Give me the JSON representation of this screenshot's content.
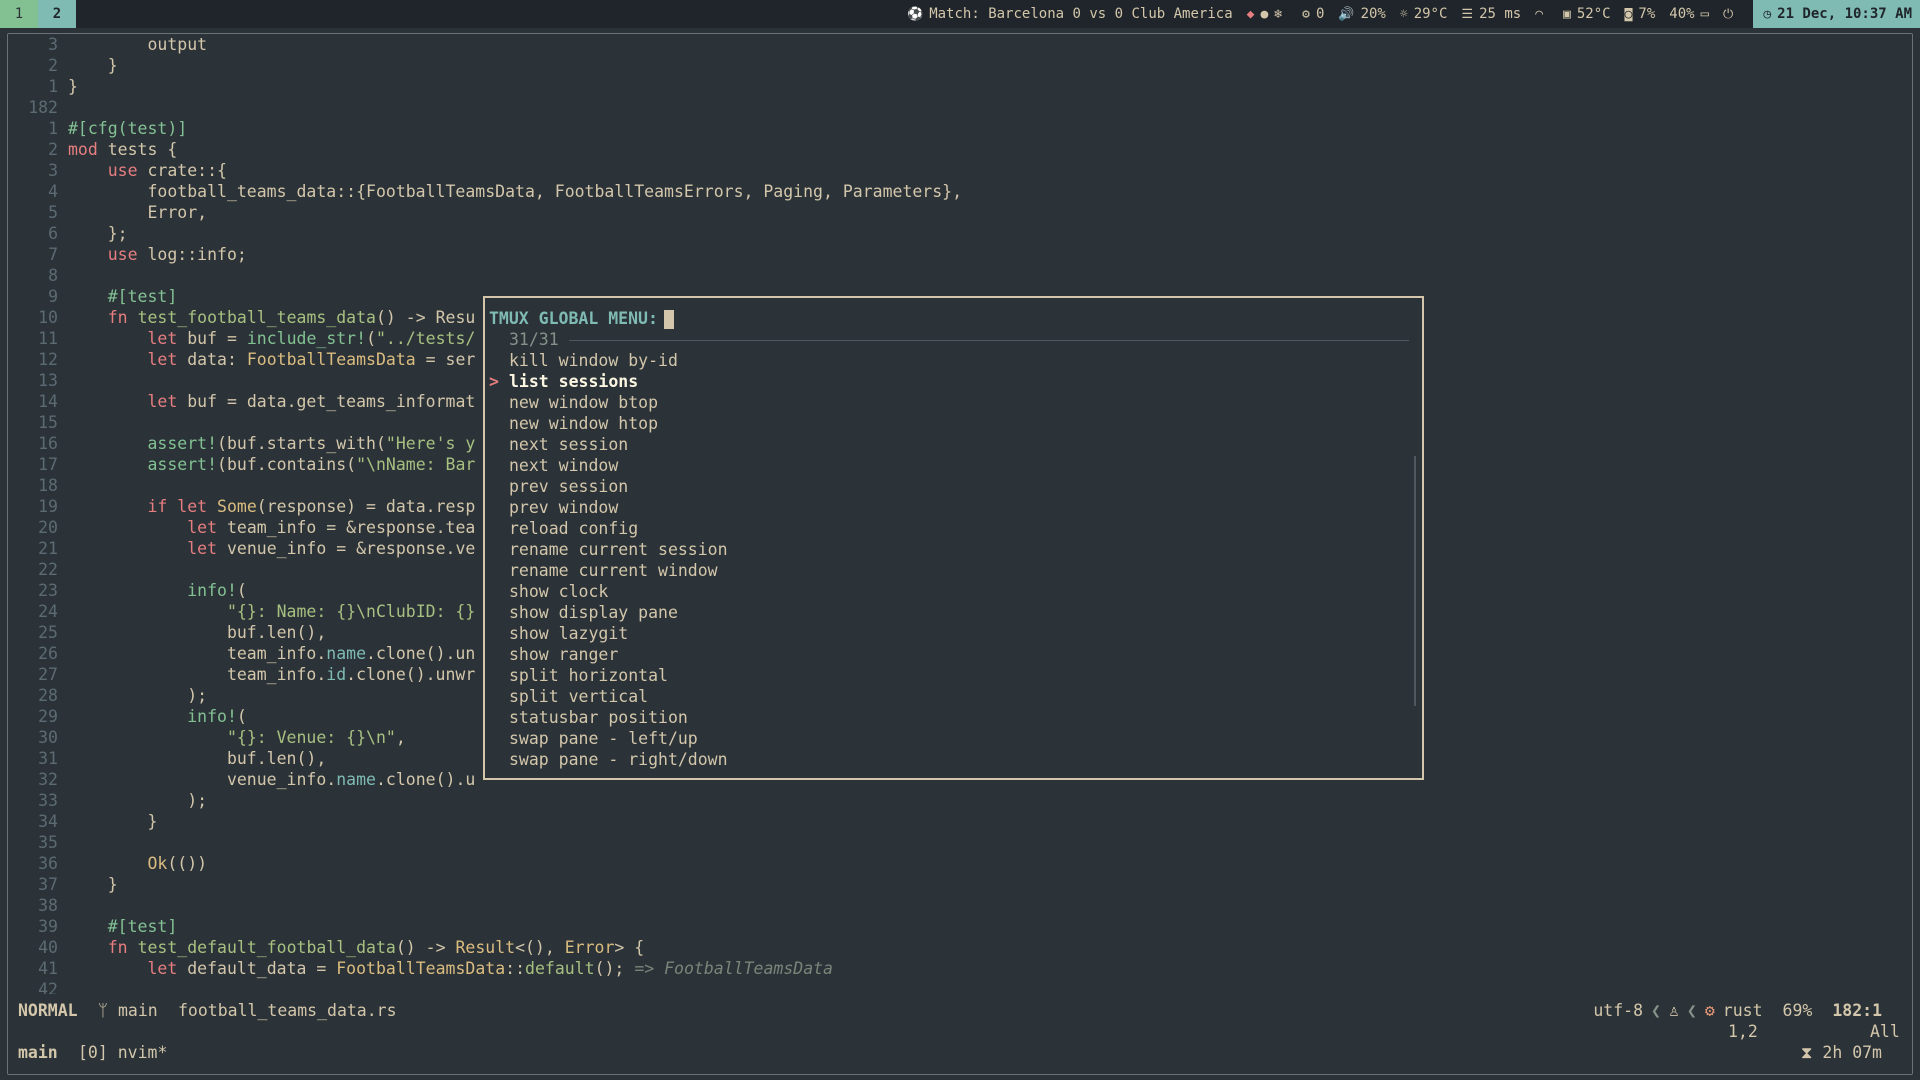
{
  "topbar": {
    "workspaces": [
      "1",
      "2"
    ],
    "match": "Match: Barcelona 0 vs 0 Club America",
    "modules": [
      {
        "icon": "⚙",
        "text": "0"
      },
      {
        "icon": "🔊",
        "text": "20%"
      },
      {
        "icon": "☼",
        "text": "29°C"
      },
      {
        "icon": "☰",
        "text": "25 ms"
      },
      {
        "icon": "◠",
        "text": ""
      },
      {
        "icon": "▣",
        "text": "52°C"
      },
      {
        "icon": "◙",
        "text": "7%"
      },
      {
        "icon": "",
        "text": "40%"
      },
      {
        "icon": "⏻",
        "text": ""
      }
    ],
    "clock": "21 Dec, 10:37 AM"
  },
  "editor": {
    "lines": [
      {
        "n": "3",
        "code": [
          [
            "",
            "        output"
          ]
        ]
      },
      {
        "n": "2",
        "code": [
          [
            "",
            "    }"
          ]
        ]
      },
      {
        "n": "1",
        "code": [
          [
            "",
            "}"
          ]
        ]
      },
      {
        "n": "182",
        "code": []
      },
      {
        "n": "1",
        "code": [
          [
            "at",
            "#[cfg(test)]"
          ]
        ]
      },
      {
        "n": "2",
        "code": [
          [
            "kw",
            "mod"
          ],
          [
            "",
            " tests {"
          ]
        ]
      },
      {
        "n": "3",
        "code": [
          [
            "",
            "    "
          ],
          [
            "kw",
            "use"
          ],
          [
            "",
            " crate::{"
          ]
        ]
      },
      {
        "n": "4",
        "code": [
          [
            "",
            "        football_teams_data::{FootballTeamsData, FootballTeamsErrors, Paging, Parameters},"
          ]
        ]
      },
      {
        "n": "5",
        "code": [
          [
            "",
            "        Error,"
          ]
        ]
      },
      {
        "n": "6",
        "code": [
          [
            "",
            "    };"
          ]
        ]
      },
      {
        "n": "7",
        "code": [
          [
            "",
            "    "
          ],
          [
            "kw",
            "use"
          ],
          [
            "",
            " log::info;"
          ]
        ]
      },
      {
        "n": "8",
        "code": []
      },
      {
        "n": "9",
        "code": [
          [
            "",
            "    "
          ],
          [
            "at",
            "#[test]"
          ]
        ]
      },
      {
        "n": "10",
        "code": [
          [
            "",
            "    "
          ],
          [
            "kw",
            "fn"
          ],
          [
            "",
            " "
          ],
          [
            "fn",
            "test_football_teams_data"
          ],
          [
            "",
            "() -> Resu"
          ]
        ]
      },
      {
        "n": "11",
        "code": [
          [
            "",
            "        "
          ],
          [
            "kw",
            "let"
          ],
          [
            "",
            " buf = "
          ],
          [
            "mc",
            "include_str!"
          ],
          [
            "",
            "("
          ],
          [
            "st",
            "\"../tests/"
          ]
        ]
      },
      {
        "n": "12",
        "code": [
          [
            "",
            "        "
          ],
          [
            "kw",
            "let"
          ],
          [
            "",
            " data: "
          ],
          [
            "ty",
            "FootballTeamsData"
          ],
          [
            "",
            " = ser"
          ]
        ]
      },
      {
        "n": "13",
        "code": []
      },
      {
        "n": "14",
        "code": [
          [
            "",
            "        "
          ],
          [
            "kw",
            "let"
          ],
          [
            "",
            " buf = data.get_teams_informat"
          ]
        ]
      },
      {
        "n": "15",
        "code": []
      },
      {
        "n": "16",
        "code": [
          [
            "",
            "        "
          ],
          [
            "mc",
            "assert!"
          ],
          [
            "",
            "(buf.starts_with("
          ],
          [
            "st",
            "\"Here's y"
          ]
        ]
      },
      {
        "n": "17",
        "code": [
          [
            "",
            "        "
          ],
          [
            "mc",
            "assert!"
          ],
          [
            "",
            "(buf.contains("
          ],
          [
            "st",
            "\"\\nName: Bar"
          ]
        ]
      },
      {
        "n": "18",
        "code": []
      },
      {
        "n": "19",
        "code": [
          [
            "",
            "        "
          ],
          [
            "kw",
            "if let"
          ],
          [
            "",
            " "
          ],
          [
            "ty",
            "Some"
          ],
          [
            "",
            "(response) = data.resp"
          ]
        ]
      },
      {
        "n": "20",
        "code": [
          [
            "",
            "            "
          ],
          [
            "kw",
            "let"
          ],
          [
            "",
            " team_info = &response.tea"
          ]
        ]
      },
      {
        "n": "21",
        "code": [
          [
            "",
            "            "
          ],
          [
            "kw",
            "let"
          ],
          [
            "",
            " venue_info = &response.ve"
          ]
        ]
      },
      {
        "n": "22",
        "code": []
      },
      {
        "n": "23",
        "code": [
          [
            "",
            "            "
          ],
          [
            "mc",
            "info!"
          ],
          [
            "",
            "("
          ]
        ]
      },
      {
        "n": "24",
        "code": [
          [
            "",
            "                "
          ],
          [
            "st",
            "\"{}: Name: {}\\nClubID: {}"
          ]
        ]
      },
      {
        "n": "25",
        "code": [
          [
            "",
            "                buf.len(),"
          ]
        ]
      },
      {
        "n": "26",
        "code": [
          [
            "",
            "                team_info."
          ],
          [
            "fl",
            "name"
          ],
          [
            "",
            ".clone().un"
          ]
        ]
      },
      {
        "n": "27",
        "code": [
          [
            "",
            "                team_info."
          ],
          [
            "fl",
            "id"
          ],
          [
            "",
            ".clone().unwr"
          ]
        ]
      },
      {
        "n": "28",
        "code": [
          [
            "",
            "            );"
          ]
        ]
      },
      {
        "n": "29",
        "code": [
          [
            "",
            "            "
          ],
          [
            "mc",
            "info!"
          ],
          [
            "",
            "("
          ]
        ]
      },
      {
        "n": "30",
        "code": [
          [
            "",
            "                "
          ],
          [
            "st",
            "\"{}: Venue: {}\\n\""
          ],
          [
            "",
            ","
          ]
        ]
      },
      {
        "n": "31",
        "code": [
          [
            "",
            "                buf.len(),"
          ]
        ]
      },
      {
        "n": "32",
        "code": [
          [
            "",
            "                venue_info."
          ],
          [
            "fl",
            "name"
          ],
          [
            "",
            ".clone().u"
          ]
        ]
      },
      {
        "n": "33",
        "code": [
          [
            "",
            "            );"
          ]
        ]
      },
      {
        "n": "34",
        "code": [
          [
            "",
            "        }"
          ]
        ]
      },
      {
        "n": "35",
        "code": []
      },
      {
        "n": "36",
        "code": [
          [
            "",
            "        "
          ],
          [
            "ty",
            "Ok"
          ],
          [
            "",
            "(())"
          ]
        ]
      },
      {
        "n": "37",
        "code": [
          [
            "",
            "    }"
          ]
        ]
      },
      {
        "n": "38",
        "code": []
      },
      {
        "n": "39",
        "code": [
          [
            "",
            "    "
          ],
          [
            "at",
            "#[test]"
          ]
        ]
      },
      {
        "n": "40",
        "code": [
          [
            "",
            "    "
          ],
          [
            "kw",
            "fn"
          ],
          [
            "",
            " "
          ],
          [
            "fn",
            "test_default_football_data"
          ],
          [
            "",
            "() -> "
          ],
          [
            "ty",
            "Result"
          ],
          [
            "",
            "<(), "
          ],
          [
            "ty",
            "Error"
          ],
          [
            "",
            "> {"
          ]
        ]
      },
      {
        "n": "41",
        "code": [
          [
            "",
            "        "
          ],
          [
            "kw",
            "let"
          ],
          [
            "",
            " default_data = "
          ],
          [
            "ty",
            "FootballTeamsData"
          ],
          [
            "",
            "::"
          ],
          [
            "fn",
            "default"
          ],
          [
            "",
            "(); "
          ],
          [
            "hint",
            "=> FootballTeamsData"
          ]
        ]
      },
      {
        "n": "42",
        "code": []
      }
    ]
  },
  "menu": {
    "title": "TMUX GLOBAL MENU:",
    "count": "31/31",
    "pointer": ">",
    "selected_index": 1,
    "items": [
      "kill window by-id",
      "list sessions",
      "new window btop",
      "new window htop",
      "next session",
      "next window",
      "prev session",
      "prev window",
      "reload config",
      "rename current session",
      "rename current window",
      "show clock",
      "show display pane",
      "show lazygit",
      "show ranger",
      "split horizontal",
      "split vertical",
      "statusbar position",
      "swap pane - left/up",
      "swap pane - right/down"
    ]
  },
  "statusline": {
    "mode": "NORMAL",
    "branch": "main",
    "file": "football_teams_data.rs",
    "encoding": "utf-8",
    "filetype": "rust",
    "progress": "69%",
    "cursor": "182:1",
    "pos": "1,2",
    "scroll": "All"
  },
  "tmux": {
    "session": "main",
    "window": "[0] nvim*",
    "uptime": "⧗ 2h 07m"
  }
}
